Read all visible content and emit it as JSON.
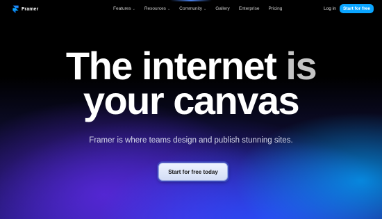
{
  "brand": {
    "name": "Framer"
  },
  "nav": {
    "items": [
      {
        "label": "Features",
        "dropdown": true
      },
      {
        "label": "Resources",
        "dropdown": true
      },
      {
        "label": "Community",
        "dropdown": true
      },
      {
        "label": "Gallery",
        "dropdown": false
      },
      {
        "label": "Enterprise",
        "dropdown": false
      },
      {
        "label": "Pricing",
        "dropdown": false
      }
    ],
    "login": "Log in",
    "start": "Start for free",
    "dropdown_icon": "chevron-down-icon"
  },
  "hero": {
    "title_line1_main": "The internet ",
    "title_line1_dim": "is",
    "title_line2": "your canvas",
    "subtitle": "Framer is where teams design and publish stunning sites.",
    "cta": "Start for free today"
  },
  "colors": {
    "accent": "#0aa5ff",
    "background": "#000000",
    "glow_blue": "#2850ff",
    "glow_purple": "#5a28dc"
  }
}
